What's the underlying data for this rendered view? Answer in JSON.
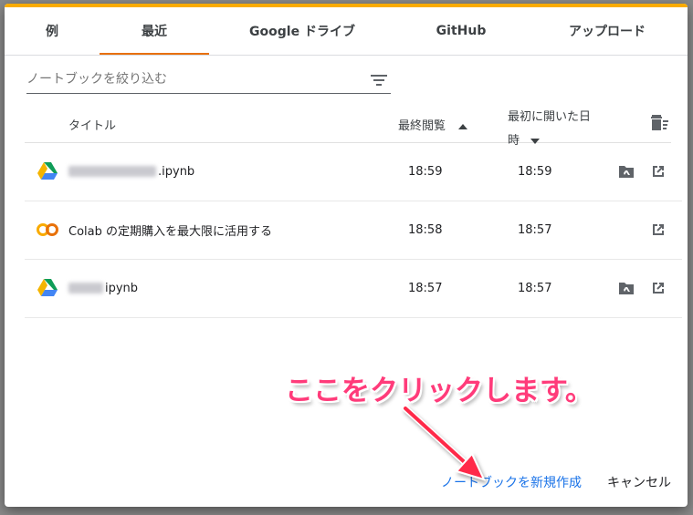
{
  "tabs": [
    {
      "label": "例"
    },
    {
      "label": "最近"
    },
    {
      "label": "Google ドライブ"
    },
    {
      "label": "GitHub"
    },
    {
      "label": "アップロード"
    }
  ],
  "filter": {
    "placeholder": "ノートブックを絞り込む"
  },
  "columns": {
    "title": "タイトル",
    "last_viewed": "最終閲覧",
    "first_opened": "最初に開いた日時"
  },
  "rows": [
    {
      "icon": "google-drive-icon",
      "title_suffix": ".ipynb",
      "last_viewed": "18:59",
      "first_opened": "18:59",
      "has_drive_folder": true
    },
    {
      "icon": "colab-icon",
      "title": "Colab の定期購入を最大限に活用する",
      "last_viewed": "18:58",
      "first_opened": "18:57",
      "has_drive_folder": false
    },
    {
      "icon": "google-drive-icon",
      "title_suffix": "ipynb",
      "last_viewed": "18:57",
      "first_opened": "18:57",
      "has_drive_folder": true
    }
  ],
  "annotation": {
    "text": "ここをクリックします。",
    "color": "#ff3b7a"
  },
  "footer": {
    "new_notebook": "ノートブックを新規作成",
    "cancel": "キャンセル"
  },
  "colors": {
    "accent": "#e8710a",
    "topbar": "#f9ab00",
    "link": "#1a73e8"
  }
}
